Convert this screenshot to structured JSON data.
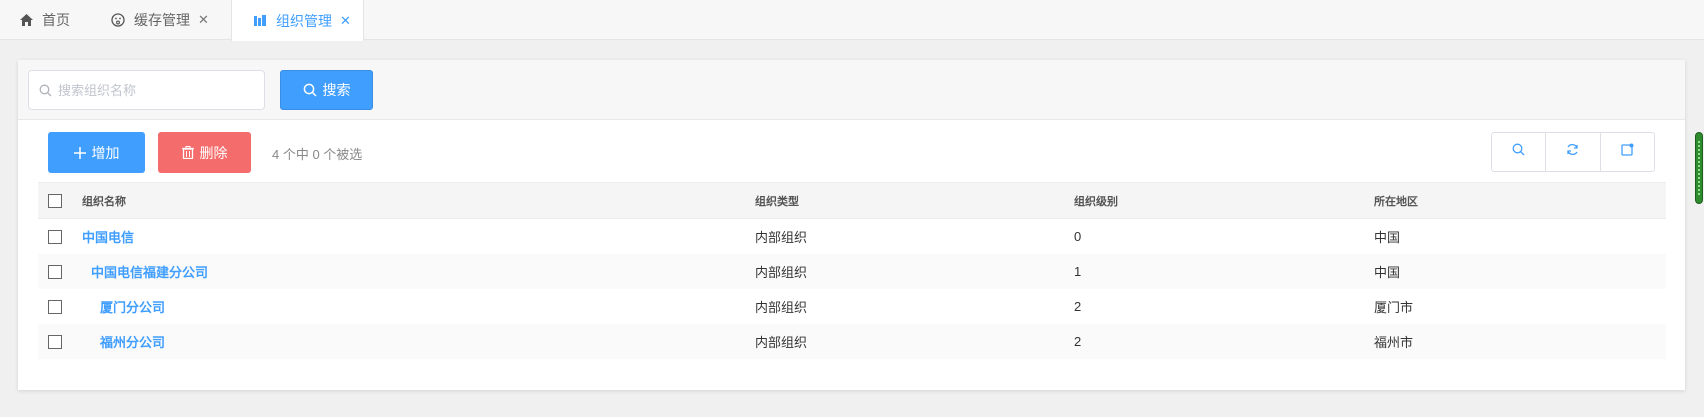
{
  "tabs": [
    {
      "label": "首页",
      "icon": "home-icon"
    },
    {
      "label": "缓存管理",
      "icon": "cache-icon",
      "closable": true
    },
    {
      "label": "组织管理",
      "icon": "org-icon",
      "closable": true,
      "active": true
    }
  ],
  "search": {
    "placeholder": "搜索组织名称",
    "value": "",
    "button_label": "搜索"
  },
  "toolbar": {
    "add_label": "增加",
    "delete_label": "删除",
    "selection_text": "4 个中 0 个被选"
  },
  "table": {
    "columns": [
      "组织名称",
      "组织类型",
      "组织级别",
      "所在地区"
    ],
    "rows": [
      {
        "name": "中国电信",
        "type": "内部组织",
        "level": "0",
        "region": "中国",
        "indent": 0
      },
      {
        "name": "中国电信福建分公司",
        "type": "内部组织",
        "level": "1",
        "region": "中国",
        "indent": 1
      },
      {
        "name": "厦门分公司",
        "type": "内部组织",
        "level": "2",
        "region": "厦门市",
        "indent": 2
      },
      {
        "name": "福州分公司",
        "type": "内部组织",
        "level": "2",
        "region": "福州市",
        "indent": 2
      }
    ]
  },
  "colors": {
    "primary": "#409eff",
    "danger": "#f56c6c"
  }
}
